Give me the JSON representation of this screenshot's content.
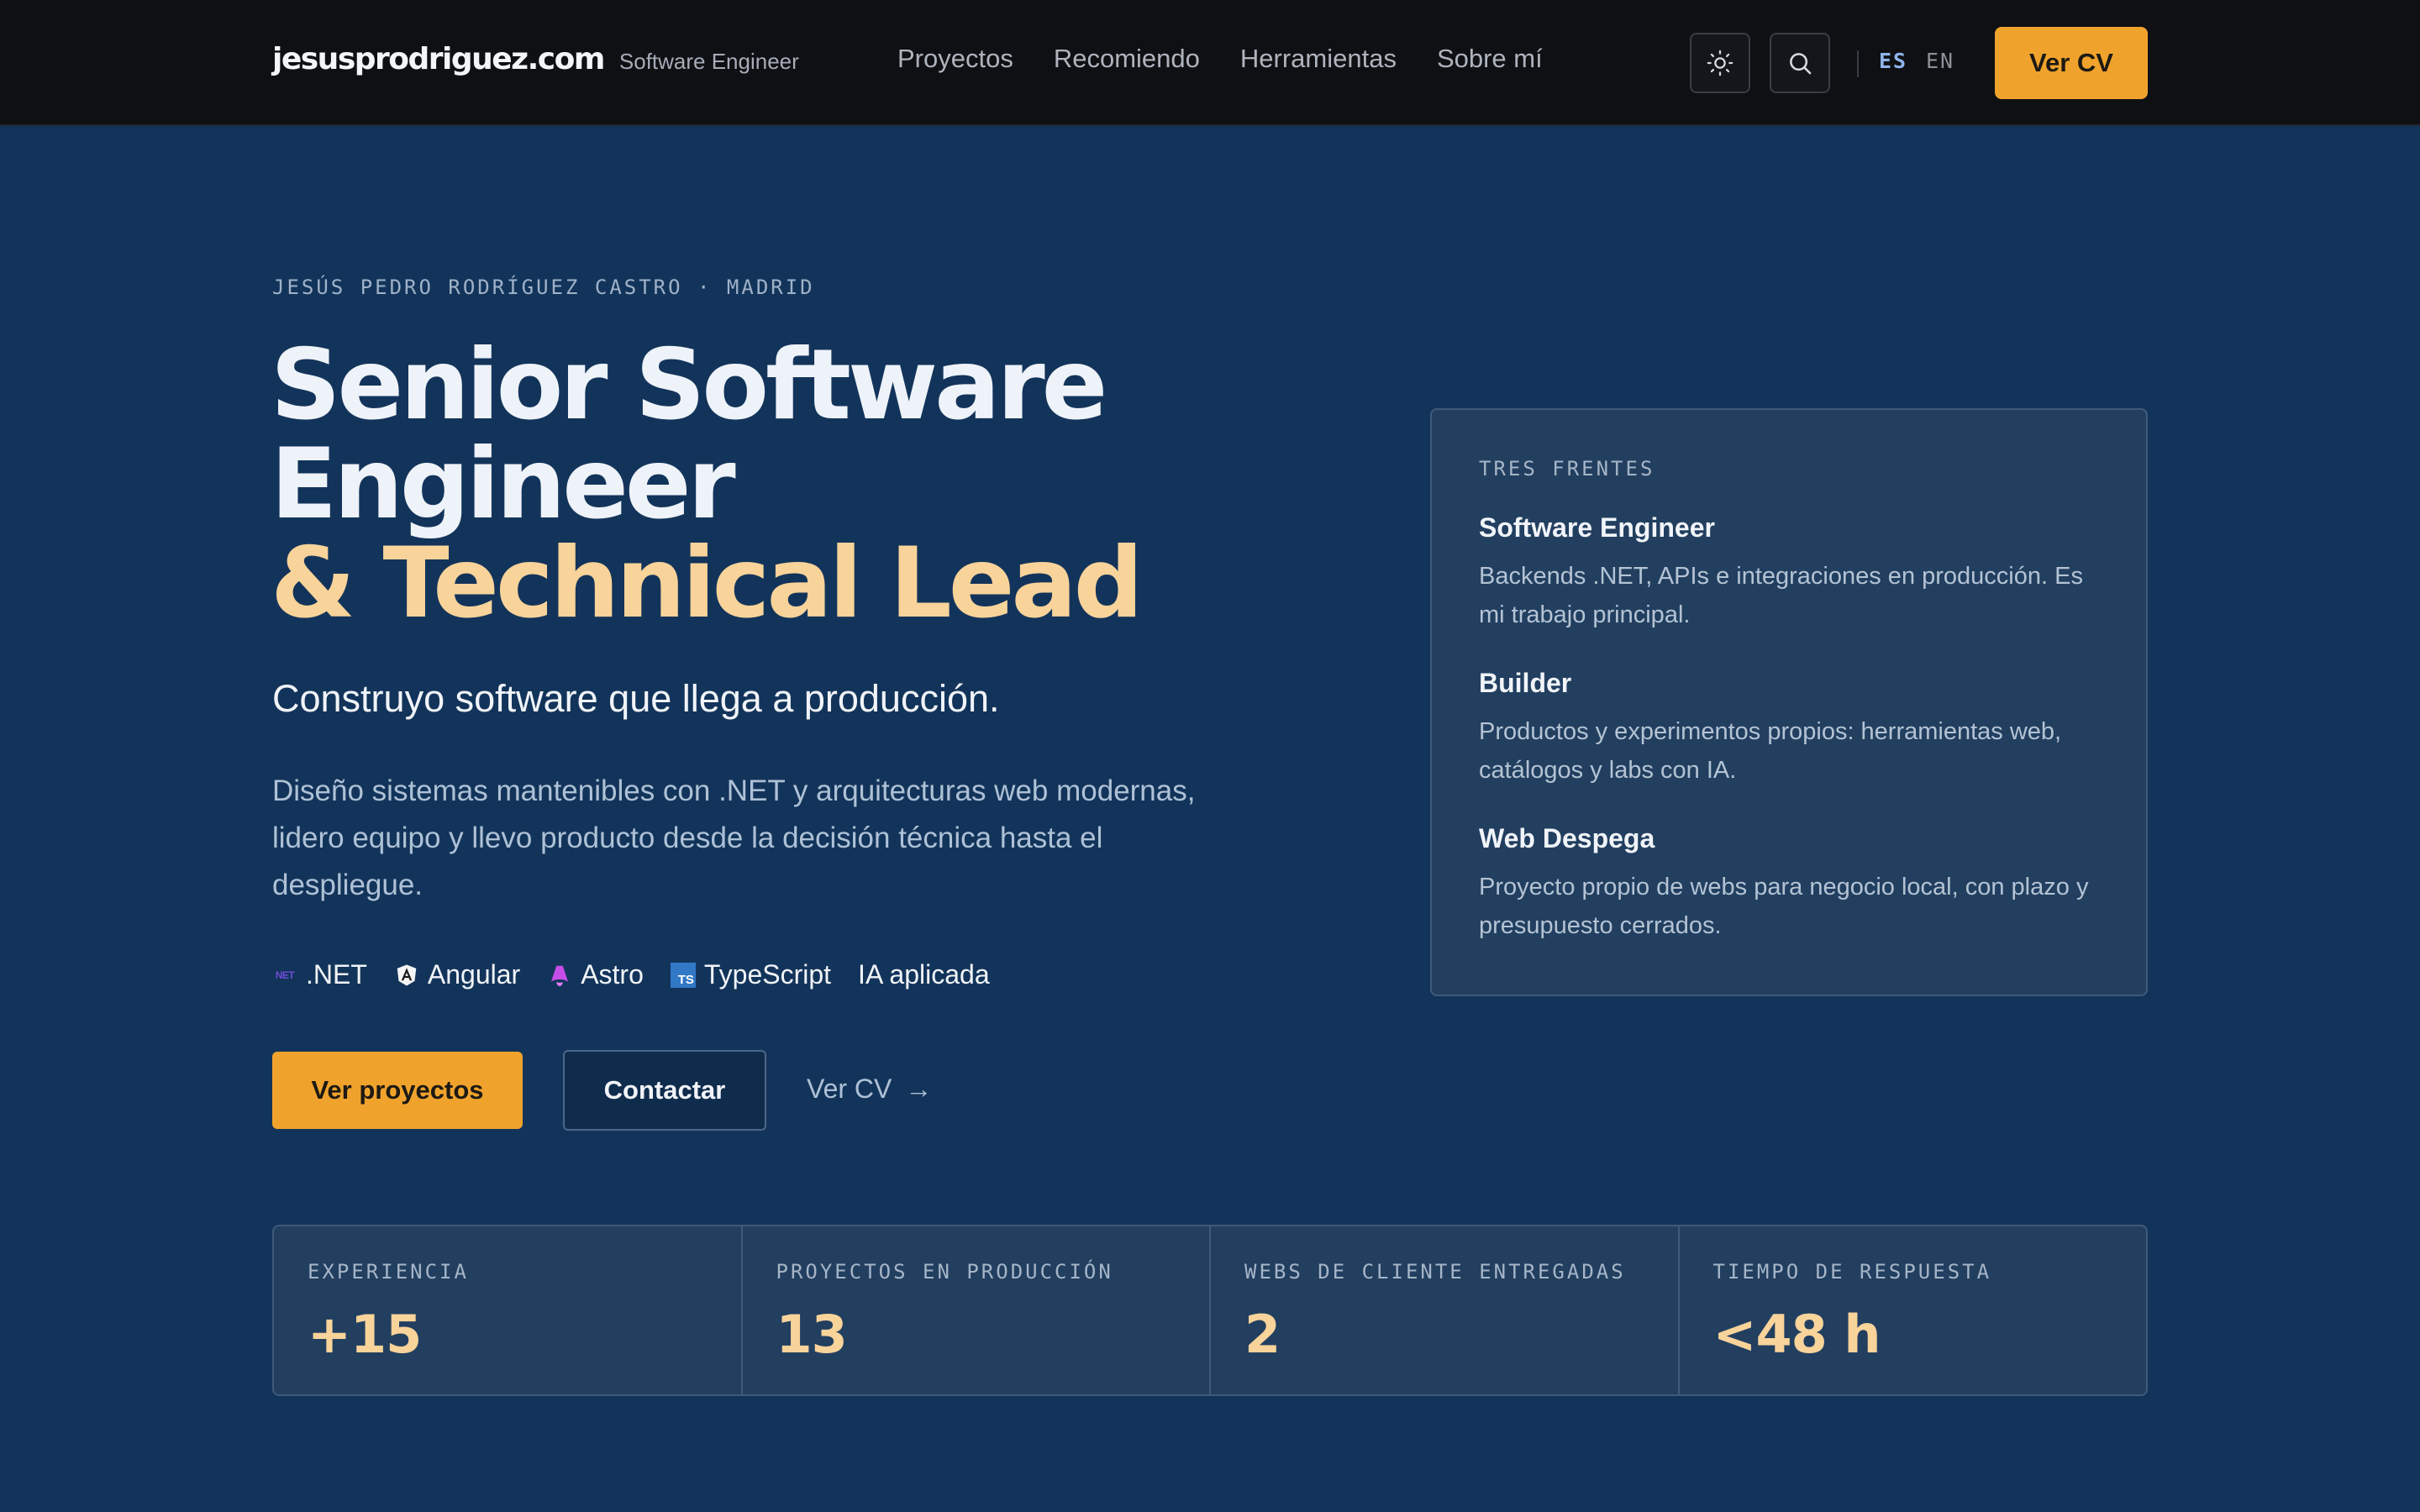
{
  "header": {
    "brand": "jesusprodriguez.com",
    "brand_role": "Software Engineer",
    "nav": [
      "Proyectos",
      "Recomiendo",
      "Herramientas",
      "Sobre mí"
    ],
    "theme_icon": "sun-icon",
    "search_icon": "search-icon",
    "lang_active": "ES",
    "lang_other": "EN",
    "cta": "Ver CV"
  },
  "hero": {
    "eyebrow": "JESÚS PEDRO RODRÍGUEZ CASTRO · MADRID",
    "headline_line1": "Senior Software",
    "headline_line2": "Engineer",
    "headline_line3": "& Technical Lead",
    "tagline": "Construyo software que llega a producción.",
    "intro": "Diseño sistemas mantenibles con .NET y arquitecturas web modernas, lidero equipo y llevo producto desde la decisión técnica hasta el despliegue.",
    "stack": [
      {
        "label": ".NET",
        "icon": "dotnet-icon",
        "icon_text": "NET"
      },
      {
        "label": "Angular",
        "icon": "angular-icon"
      },
      {
        "label": "Astro",
        "icon": "astro-icon"
      },
      {
        "label": "TypeScript",
        "icon": "typescript-icon",
        "icon_text": "TS"
      },
      {
        "label": "IA aplicada"
      }
    ],
    "btn_projects": "Ver proyectos",
    "btn_contact": "Contactar",
    "link_cv": "Ver CV",
    "link_cv_arrow": "→"
  },
  "card": {
    "eyebrow": "TRES FRENTES",
    "fronts": [
      {
        "title": "Software Engineer",
        "desc": "Backends .NET, APIs e integraciones en producción. Es mi trabajo principal."
      },
      {
        "title": "Builder",
        "desc": "Productos y experimentos propios: herramientas web, catálogos y labs con IA."
      },
      {
        "title": "Web Despega",
        "desc": "Proyecto propio de webs para negocio local, con plazo y presupuesto cerrados."
      }
    ]
  },
  "stats": [
    {
      "label": "EXPERIENCIA",
      "value": "+15"
    },
    {
      "label": "PROYECTOS EN PRODUCCIÓN",
      "value": "13"
    },
    {
      "label": "WEBS DE CLIENTE ENTREGADAS",
      "value": "2"
    },
    {
      "label": "TIEMPO DE RESPUESTA",
      "value": "<48 h"
    }
  ],
  "colors": {
    "background": "#13345a",
    "topbar": "#0f1014",
    "accent": "#f0a32c",
    "accent_text": "#f8d39a",
    "card": "#223f60"
  }
}
